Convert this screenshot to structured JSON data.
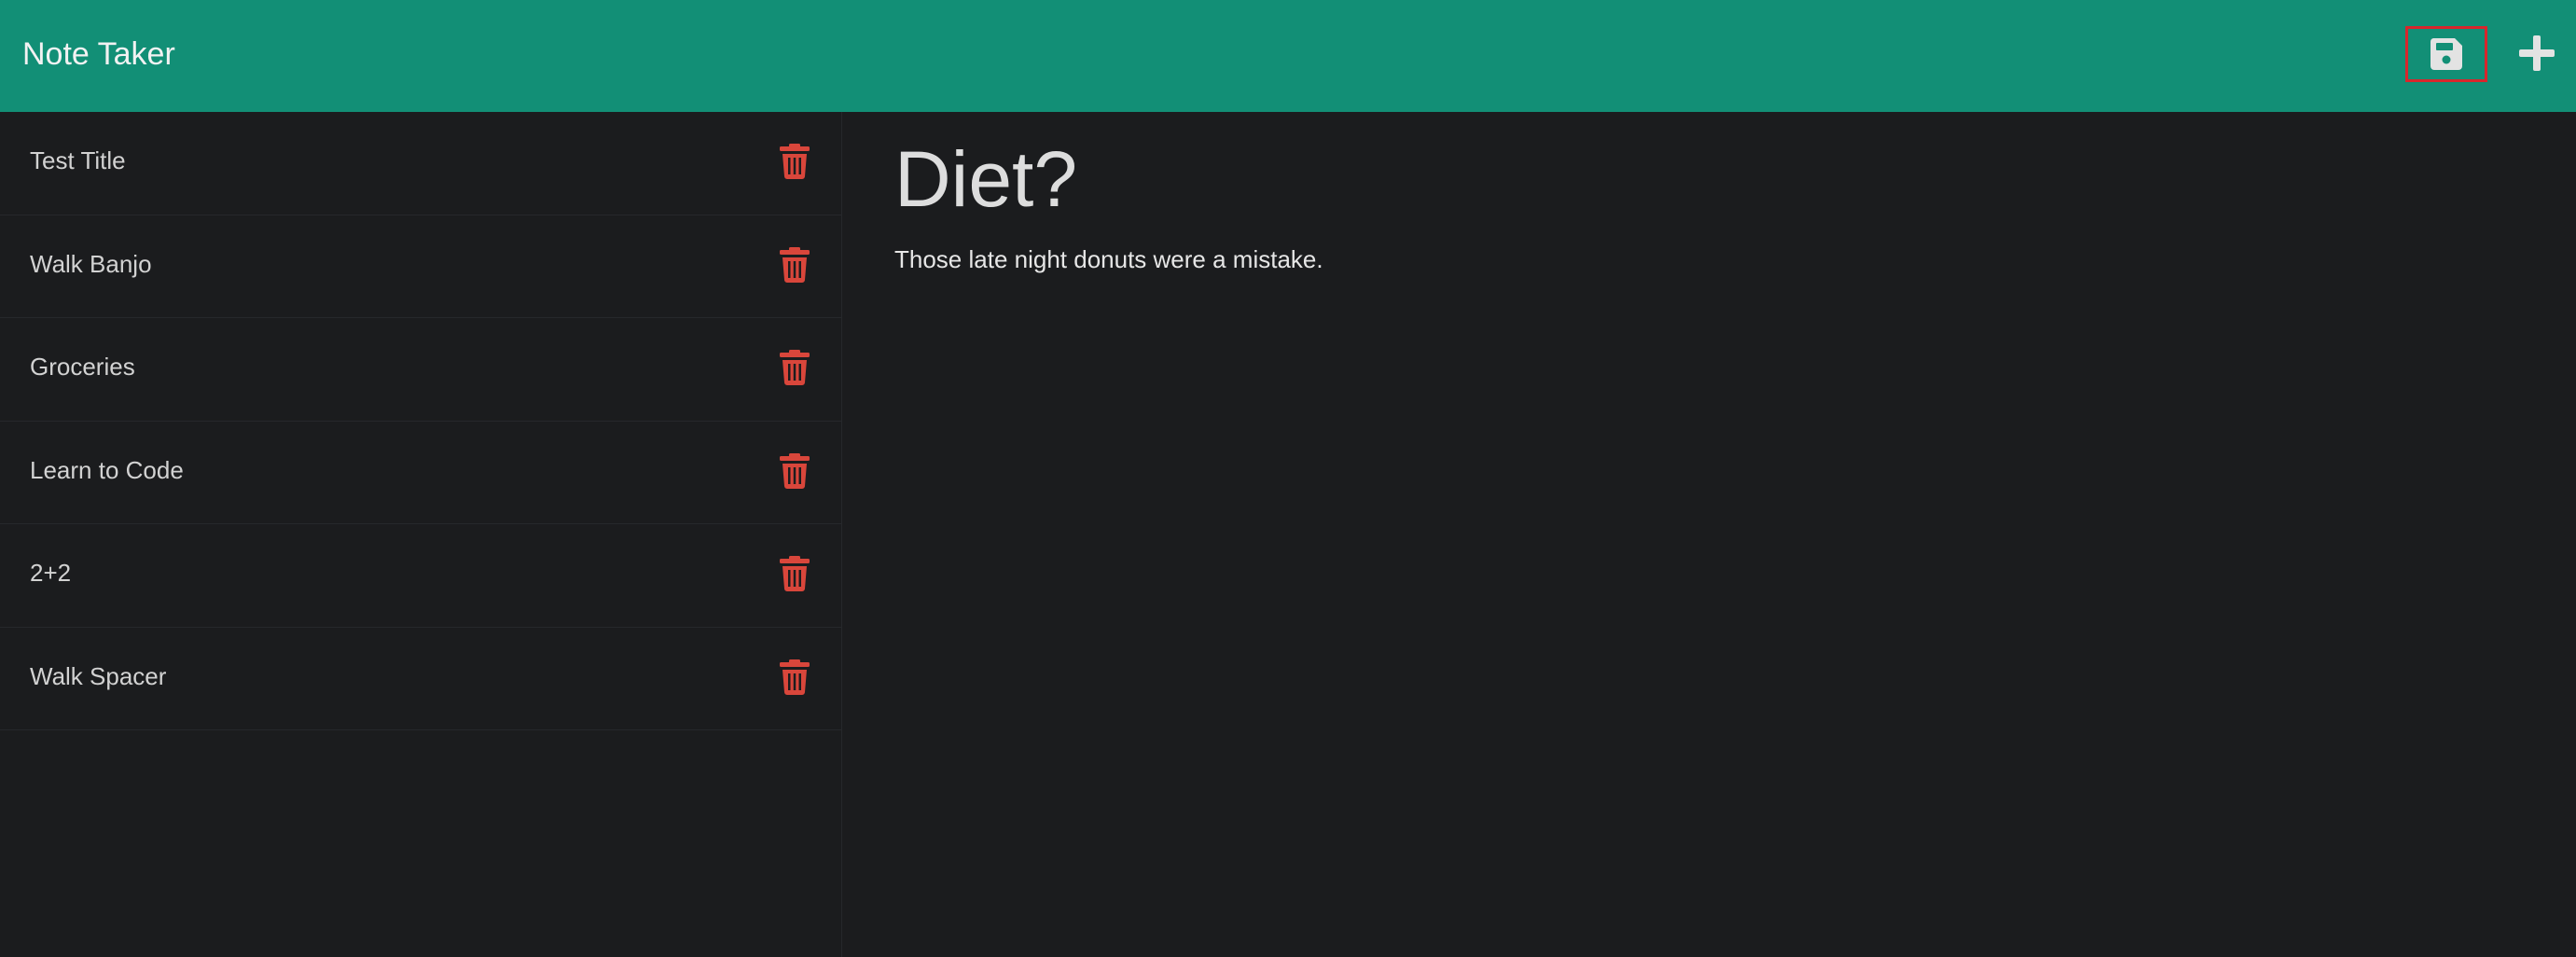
{
  "app": {
    "title": "Note Taker"
  },
  "toolbar": {
    "save_icon": "floppy-disk-icon",
    "new_icon": "plus-icon",
    "highlight_color": "#d8262c",
    "icon_color": "#e3e3e3"
  },
  "notes": [
    {
      "title": "Test Title"
    },
    {
      "title": "Walk Banjo"
    },
    {
      "title": "Groceries"
    },
    {
      "title": "Learn to Code"
    },
    {
      "title": "2+2"
    },
    {
      "title": "Walk Spacer"
    }
  ],
  "active_note": {
    "title": "Diet?",
    "text": "Those late night donuts were a mistake."
  },
  "colors": {
    "navbar": "#128f76",
    "background": "#1b1c1e",
    "delete": "#d9463b"
  }
}
